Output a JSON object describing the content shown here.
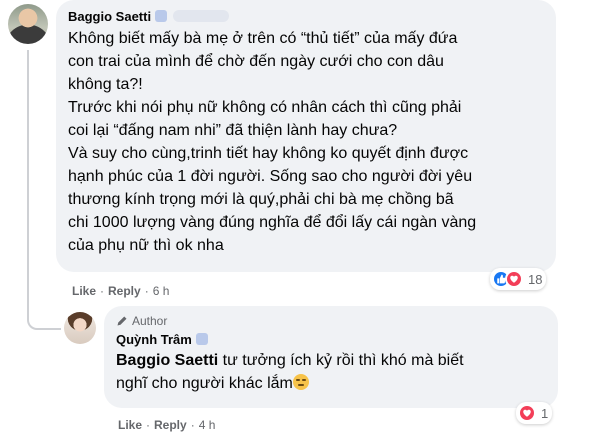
{
  "main_comment": {
    "author": "Baggio Saetti",
    "text": "Không biết mấy bà mẹ ở trên có “thủ tiết” của mấy đứa\ncon trai của mình để chờ đến ngày cưới cho con dâu\nkhông ta?!\nTrước khi nói phụ nữ không có nhân cách thì cũng phải\ncoi lại “đấng nam nhi” đã thiện lành hay chưa?\nVà suy cho cùng,trinh tiết hay không ko quyết định được\nhạnh phúc của 1 đời người. Sống sao cho người đời yêu\nthương kính trọng mới là quý,phải chi bà mẹ chồng bã\nchi 1000 lượng vàng đúng nghĩa để đổi lấy cái ngàn vàng\ncủa phụ nữ thì ok nha",
    "reaction_count": "18",
    "actions": {
      "like": "Like",
      "reply": "Reply",
      "sep": "·",
      "time": "6 h"
    }
  },
  "reply_comment": {
    "badge": "Author",
    "author": "Quỳnh Trâm",
    "mention": "Baggio Saetti",
    "text": " tư tưởng ích kỷ rồi thì khó mà biết\nnghĩ cho người khác lắm",
    "reaction_count": "1",
    "actions": {
      "like": "Like",
      "reply": "Reply",
      "sep": "·",
      "time": "4 h"
    }
  },
  "colors": {
    "bubble": "#f0f2f5",
    "text": "#050505",
    "secondary": "#65676b",
    "like_blue": "#1877f2",
    "love_red": "#f33e58"
  },
  "icons": [
    "like-reaction-icon",
    "love-reaction-icon",
    "pencil-icon",
    "sweat-smile-emoji"
  ]
}
